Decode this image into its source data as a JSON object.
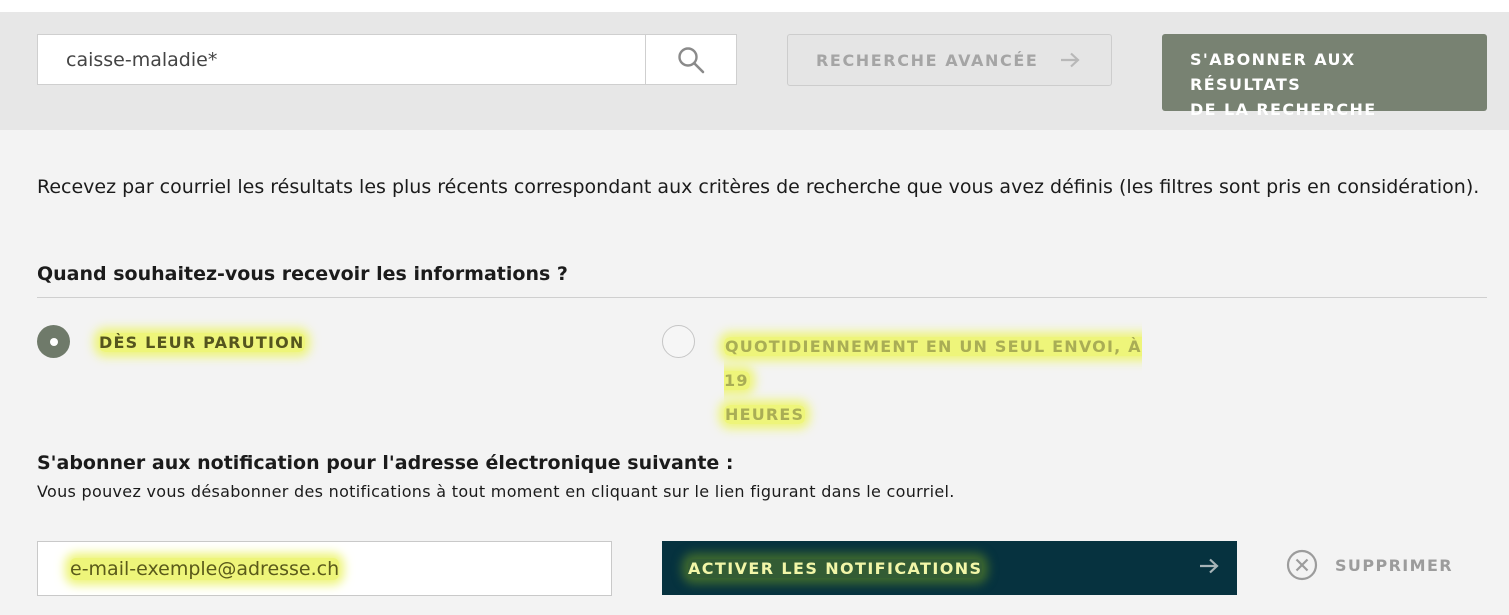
{
  "search": {
    "value": "caisse-maladie*",
    "icon": "search-icon"
  },
  "toolbar": {
    "advanced_label": "RECHERCHE AVANCÉE",
    "subscribe_line1": "S'ABONNER AUX RÉSULTATS",
    "subscribe_line2": "DE LA RECHERCHE"
  },
  "intro_text": "Recevez par courriel les résultats les plus récents correspondant aux critères de recherche que vous avez définis (les filtres sont pris en considération).",
  "frequency": {
    "title": "Quand souhaitez-vous recevoir les informations ?",
    "options": [
      {
        "label": "DÈS LEUR PARUTION",
        "checked": true
      },
      {
        "label_line1": "QUOTIDIENNEMENT EN UN SEUL ENVOI, À 19",
        "label_line2": "HEURES",
        "checked": false
      }
    ]
  },
  "email": {
    "title": "S'abonner aux notification pour l'adresse électronique suivante :",
    "subtitle": "Vous pouvez vous désabonner des notifications à tout moment en cliquant sur le lien figurant dans le courriel.",
    "value": "e-mail-exemple@adresse.ch",
    "activate_label": "ACTIVER LES NOTIFICATIONS",
    "delete_label": "SUPPRIMER"
  },
  "colors": {
    "accent_green": "#788272",
    "dark_teal": "#06323f",
    "highlight": "#eef57a"
  }
}
